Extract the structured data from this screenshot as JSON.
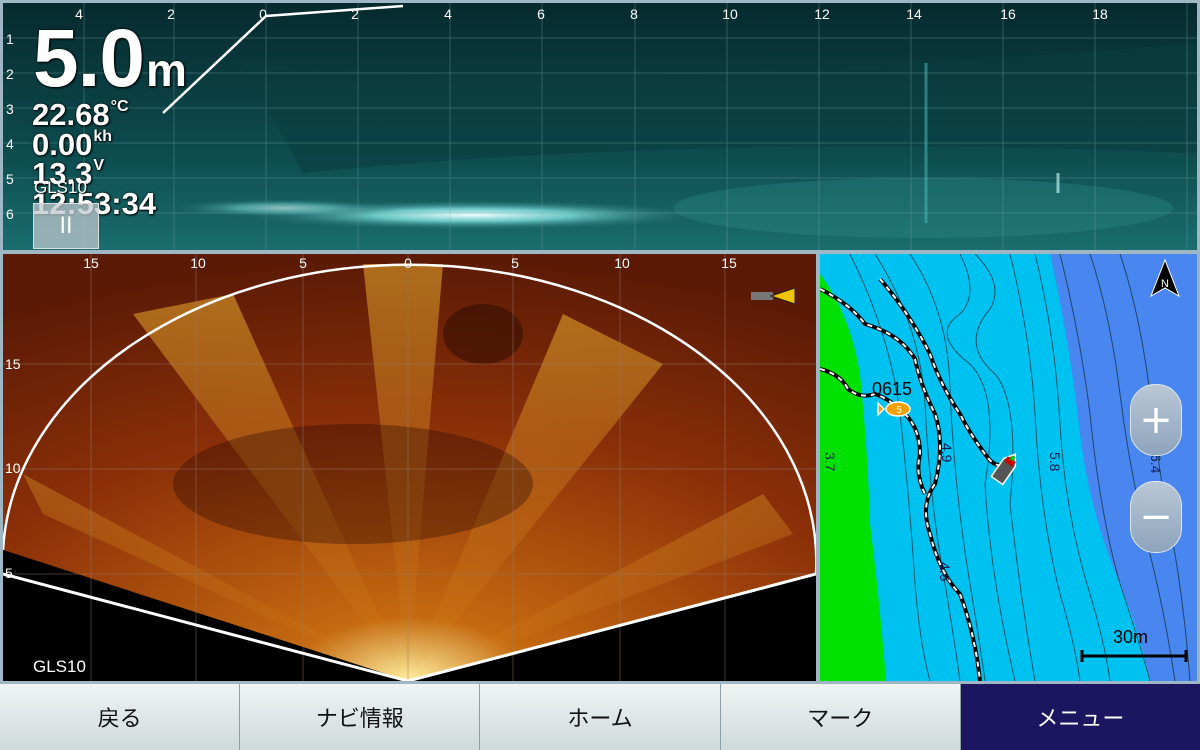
{
  "top_sonar": {
    "x_ticks": [
      "4",
      "2",
      "0",
      "2",
      "4",
      "6",
      "8",
      "10",
      "12",
      "14",
      "16",
      "18"
    ],
    "y_ticks": [
      "1",
      "2",
      "3",
      "4",
      "5",
      "6"
    ],
    "depth_value": "5.0",
    "depth_unit": "m",
    "temperature": "22.68",
    "temperature_unit": "°C",
    "speed": "0.00",
    "speed_unit": "kh",
    "voltage": "13.3",
    "voltage_unit": "V",
    "time": "12:53:34",
    "source": "GLS10",
    "pause_label": "II"
  },
  "fan_sonar": {
    "x_ticks": [
      "15",
      "10",
      "5",
      "0",
      "5",
      "10",
      "15"
    ],
    "y_ticks": [
      "15",
      "10",
      "5"
    ],
    "source": "GLS10"
  },
  "chart": {
    "waypoint_label": "0615",
    "waypoint_badge": "5",
    "depth_labels": [
      "3.7",
      "4.9",
      "4.6",
      "5.8",
      "6.4"
    ],
    "scale_label": "30m",
    "north_label": "N",
    "zoom_in_label": "+",
    "zoom_out_label": "−"
  },
  "nav": {
    "back": "戻る",
    "nav_info": "ナビ情報",
    "home": "ホーム",
    "mark": "マーク",
    "menu": "メニュー"
  }
}
